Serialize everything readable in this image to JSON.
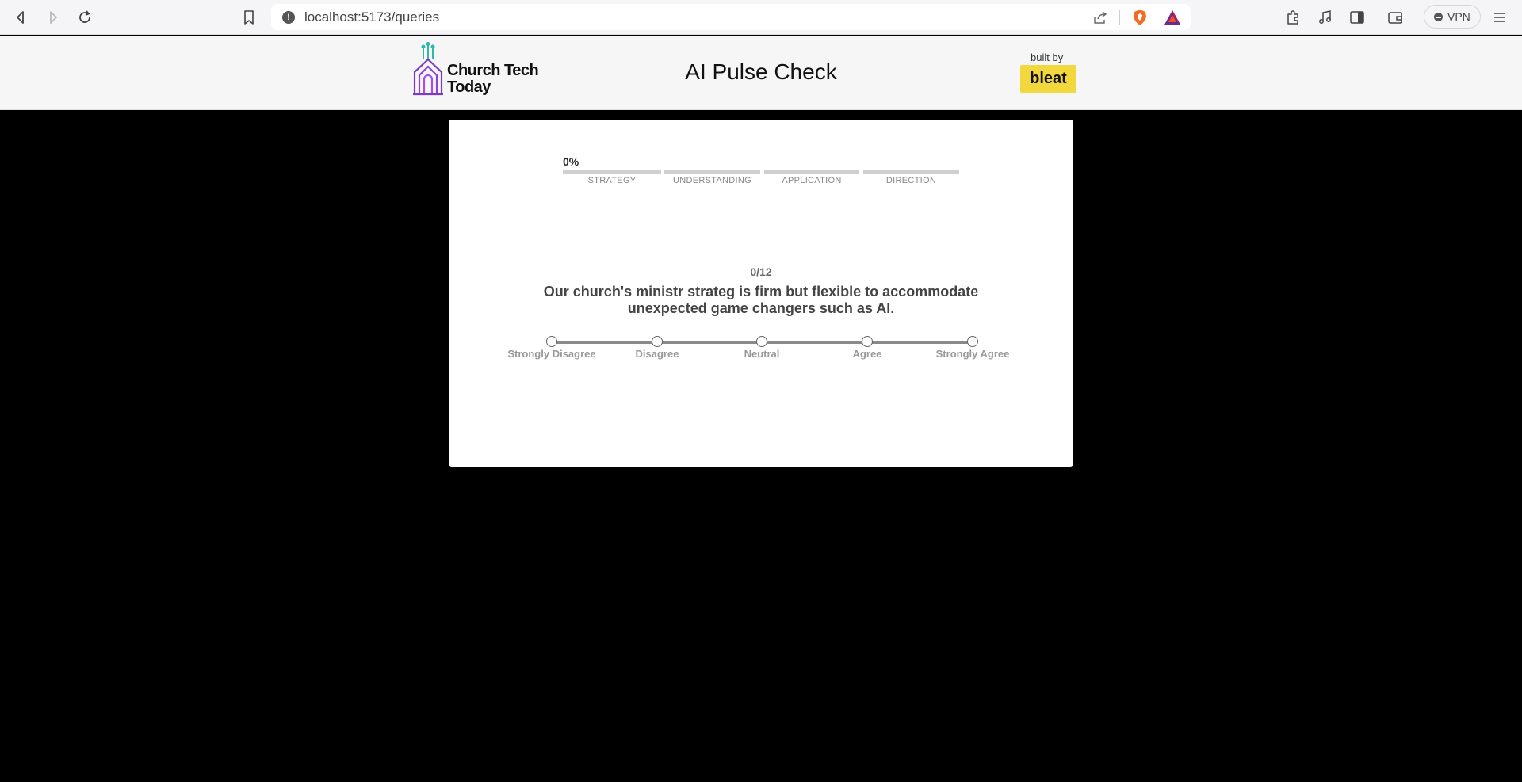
{
  "browser": {
    "url": "localhost:5173/queries",
    "vpn_label": "VPN"
  },
  "header": {
    "logo_line1": "Church Tech",
    "logo_line2": "Today",
    "title": "AI Pulse Check",
    "built_by": "built by",
    "badge": "bleat"
  },
  "quiz": {
    "progress_percent": "0%",
    "progress_fraction": 0,
    "sections": [
      "STRATEGY",
      "UNDERSTANDING",
      "APPLICATION",
      "DIRECTION"
    ],
    "counter": "0/12",
    "question": "Our church's ministr strateg is firm but flexible to accommodate unexpected game changers such as AI.",
    "options": [
      "Strongly Disagree",
      "Disagree",
      "Neutral",
      "Agree",
      "Strongly Agree"
    ]
  },
  "colors": {
    "badge_bg": "#f3d83d",
    "page_bg": "#000000",
    "track": "#8a8a8a"
  }
}
